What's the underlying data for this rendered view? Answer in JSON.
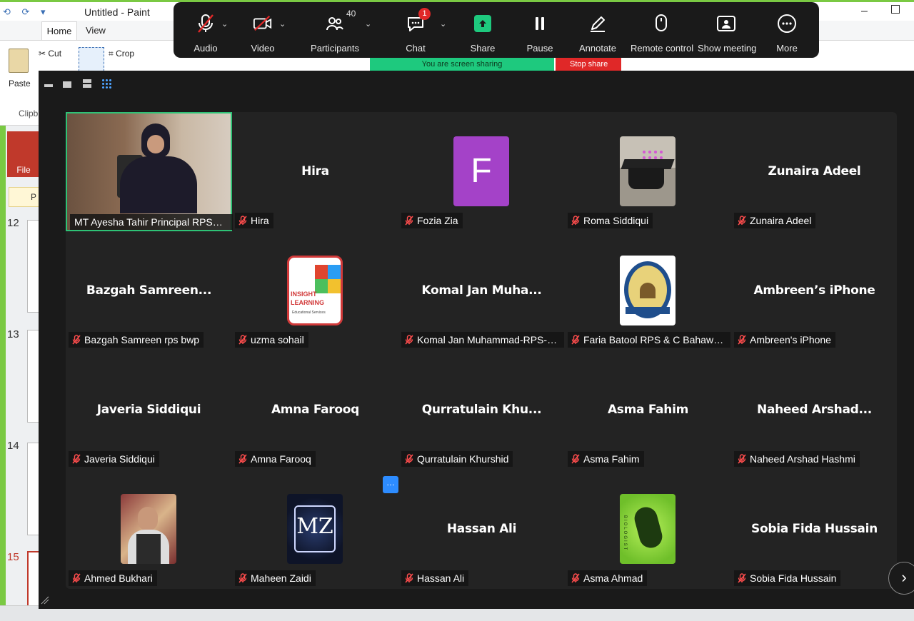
{
  "paint": {
    "title": "Untitled - Paint",
    "tabs": [
      "Home",
      "View"
    ],
    "ribbon": {
      "paste": "Paste",
      "cut": "Cut",
      "crop": "Crop",
      "clipboard": "Clipb"
    },
    "file_label": "File",
    "shield_text": "P",
    "slide_numbers": [
      "12",
      "13",
      "14",
      "15"
    ]
  },
  "toolbar": {
    "audio": "Audio",
    "video": "Video",
    "participants": "Participants",
    "participants_count": "40",
    "chat": "Chat",
    "chat_badge": "1",
    "share": "Share",
    "pause": "Pause",
    "annotate": "Annotate",
    "remote_control": "Remote control",
    "show_meeting": "Show meeting",
    "more": "More"
  },
  "sharing_banner": "You are screen sharing",
  "stop_share": "Stop share",
  "tiles": [
    {
      "display": "",
      "label": "MT Ayesha Tahir Principal RPS&C Bwp",
      "kind": "video"
    },
    {
      "display": "Hira",
      "label": "Hira",
      "kind": "name"
    },
    {
      "display": "F",
      "label": "Fozia Zia",
      "kind": "letter"
    },
    {
      "display": "",
      "label": "Roma Siddiqui",
      "kind": "photo-cap"
    },
    {
      "display": "Zunaira Adeel",
      "label": "Zunaira Adeel",
      "kind": "name"
    },
    {
      "display": "Bazgah  Samreen...",
      "label": "Bazgah Samreen rps bwp",
      "kind": "name"
    },
    {
      "display": "",
      "label": "uzma sohail",
      "kind": "photo-insight",
      "logo_text": [
        "INSIGHT",
        "LEARNING",
        "Educational Services"
      ]
    },
    {
      "display": "Komal  Jan  Muha...",
      "label": "Komal Jan Muhammad-RPS-Bahaw...",
      "kind": "name"
    },
    {
      "display": "",
      "label": "Faria Batool RPS & C Bahawalpur",
      "kind": "photo-crest"
    },
    {
      "display": "Ambreen’s iPhone",
      "label": "Ambreen's iPhone",
      "kind": "name"
    },
    {
      "display": "Javeria  Siddiqui",
      "label": "Javeria Siddiqui",
      "kind": "name"
    },
    {
      "display": "Amna  Farooq",
      "label": "Amna Farooq",
      "kind": "name"
    },
    {
      "display": "Qurratulain  Khu...",
      "label": "Qurratulain Khurshid",
      "kind": "name"
    },
    {
      "display": "Asma  Fahim",
      "label": "Asma Fahim",
      "kind": "name"
    },
    {
      "display": "Naheed  Arshad...",
      "label": "Naheed Arshad Hashmi",
      "kind": "name"
    },
    {
      "display": "",
      "label": "Ahmed Bukhari",
      "kind": "photo-man"
    },
    {
      "display": "",
      "label": "Maheen Zaidi",
      "kind": "photo-mz",
      "logo_text": [
        "MZ"
      ]
    },
    {
      "display": "Hassan Ali",
      "label": "Hassan Ali",
      "kind": "name"
    },
    {
      "display": "",
      "label": "Asma Ahmad",
      "kind": "photo-frog",
      "logo_text": [
        "BIOLOGIST"
      ]
    },
    {
      "display": "Sobia Fida Hussain",
      "label": "Sobia Fida Hussain",
      "kind": "name"
    }
  ],
  "colors": {
    "zoom_bg": "#1a1a1a",
    "tile_bg": "#232323",
    "active_border": "#2ec276",
    "letter_avatar": "#a442c8",
    "share_green": "#1ec97e",
    "mute_red": "#e02828"
  }
}
